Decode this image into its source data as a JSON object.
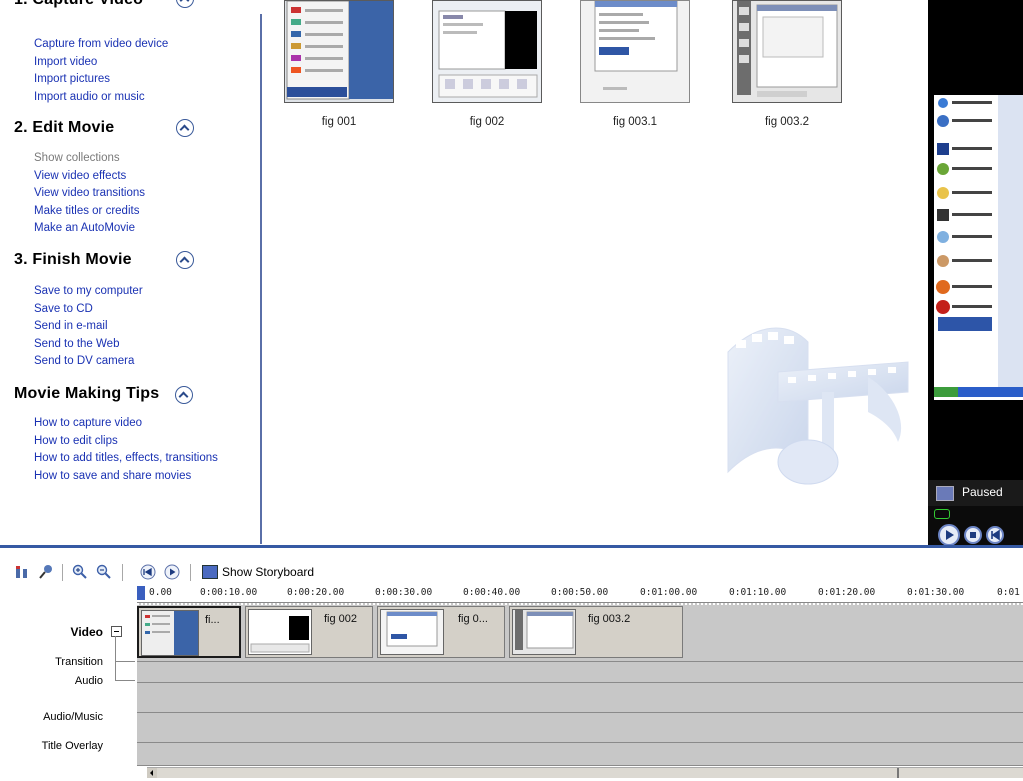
{
  "task_pane": {
    "capture_video": {
      "title": "1. Capture Video",
      "items": [
        "Capture from video device",
        "Import video",
        "Import pictures",
        "Import audio or music"
      ]
    },
    "edit_movie": {
      "title": "2. Edit Movie",
      "items": [
        "Show collections",
        "View video effects",
        "View video transitions",
        "Make titles or credits",
        "Make an AutoMovie"
      ]
    },
    "finish_movie": {
      "title": "3. Finish Movie",
      "items": [
        "Save to my computer",
        "Save to CD",
        "Send in e-mail",
        "Send to the Web",
        "Send to DV camera"
      ]
    },
    "tips": {
      "title": "Movie Making Tips",
      "items": [
        "How to capture video",
        "How to edit clips",
        "How to add titles, effects, transitions",
        "How to save and share movies"
      ]
    }
  },
  "collection": {
    "clips": [
      {
        "caption": "fig 001"
      },
      {
        "caption": "fig 002"
      },
      {
        "caption": "fig 003.1"
      },
      {
        "caption": "fig 003.2"
      }
    ]
  },
  "monitor": {
    "status": "Paused"
  },
  "timeline": {
    "toolbar": {
      "show_storyboard": "Show Storyboard"
    },
    "ruler_ticks": [
      "0.00",
      "0:00:10.00",
      "0:00:20.00",
      "0:00:30.00",
      "0:00:40.00",
      "0:00:50.00",
      "0:01:00.00",
      "0:01:10.00",
      "0:01:20.00",
      "0:01:30.00",
      "0:01"
    ],
    "tracks": {
      "video": "Video",
      "transition": "Transition",
      "audio": "Audio",
      "audio_music": "Audio/Music",
      "title_overlay": "Title Overlay"
    },
    "clips": [
      {
        "name": "fi..."
      },
      {
        "name": "fig 002"
      },
      {
        "name": "fig 0..."
      },
      {
        "name": "fig 003.2"
      }
    ]
  },
  "colors": {
    "link": "#1a32b3",
    "muted_link": "#7a7a7a",
    "accent": "#3559a3",
    "track_bg": "#c7c7c7"
  }
}
